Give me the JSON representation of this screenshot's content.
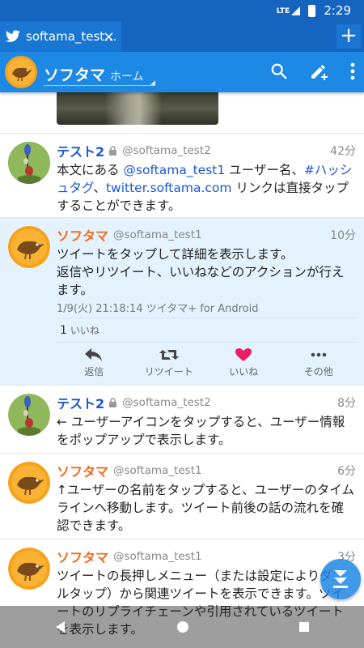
{
  "status_bar": {
    "network": "LTE",
    "time": "2:29"
  },
  "tab": {
    "label": "softama_test…",
    "close": "×",
    "add": "+"
  },
  "app_bar": {
    "title": "ソフタマ",
    "subtitle": "ホーム",
    "icons": [
      "search-icon",
      "compose-icon",
      "more-vert-icon"
    ]
  },
  "colors": {
    "status_bar": "#1565c0",
    "app_bar": "#1e88e5",
    "user_name_blue": "#1a56d6",
    "user_name_orange": "#f26a1b",
    "selected_bg": "#e3f2fd",
    "like_heart": "#e91e63"
  },
  "tweets": [
    {
      "name": "テスト2",
      "screen_name": "@softama_test2",
      "age": "42分",
      "text_1": "本文にある ",
      "link_1": "@softama_test1",
      "text_2": " ユーザー名、",
      "link_2": "#ハッシュタグ",
      "text_3": "、",
      "link_3": "twitter.softama.com",
      "text_4": " リンクは直接タップすることができます。"
    },
    {
      "name": "ソフタマ",
      "screen_name": "@softama_test1",
      "age": "10分",
      "text": "ツイートをタップして詳細を表示します。\n返信やリツイート、いいねなどのアクションが行えます。",
      "via": "1/9(火) 21:18:14 ツイタマ+ for Android",
      "like_count": "1",
      "like_label": "いいね",
      "actions": [
        "返信",
        "リツイート",
        "いいね",
        "その他"
      ]
    },
    {
      "name": "テスト2",
      "screen_name": "@softama_test2",
      "age": "8分",
      "text": "← ユーザーアイコンをタップすると、ユーザー情報をポップアップで表示します。"
    },
    {
      "name": "ソフタマ",
      "screen_name": "@softama_test1",
      "age": "6分",
      "text": "↑ユーザーの名前をタップすると、ユーザーのタイムラインへ移動します。ツイート前後の話の流れを確認できます。"
    },
    {
      "name": "ソフタマ",
      "screen_name": "@softama_test1",
      "age": "3分",
      "text": "ツイートの長押しメニュー（または設定によりダブルタップ）から関連ツイートを表示できます。ツイートのリプライチェーンや引用されているツイートを表示します。"
    }
  ]
}
